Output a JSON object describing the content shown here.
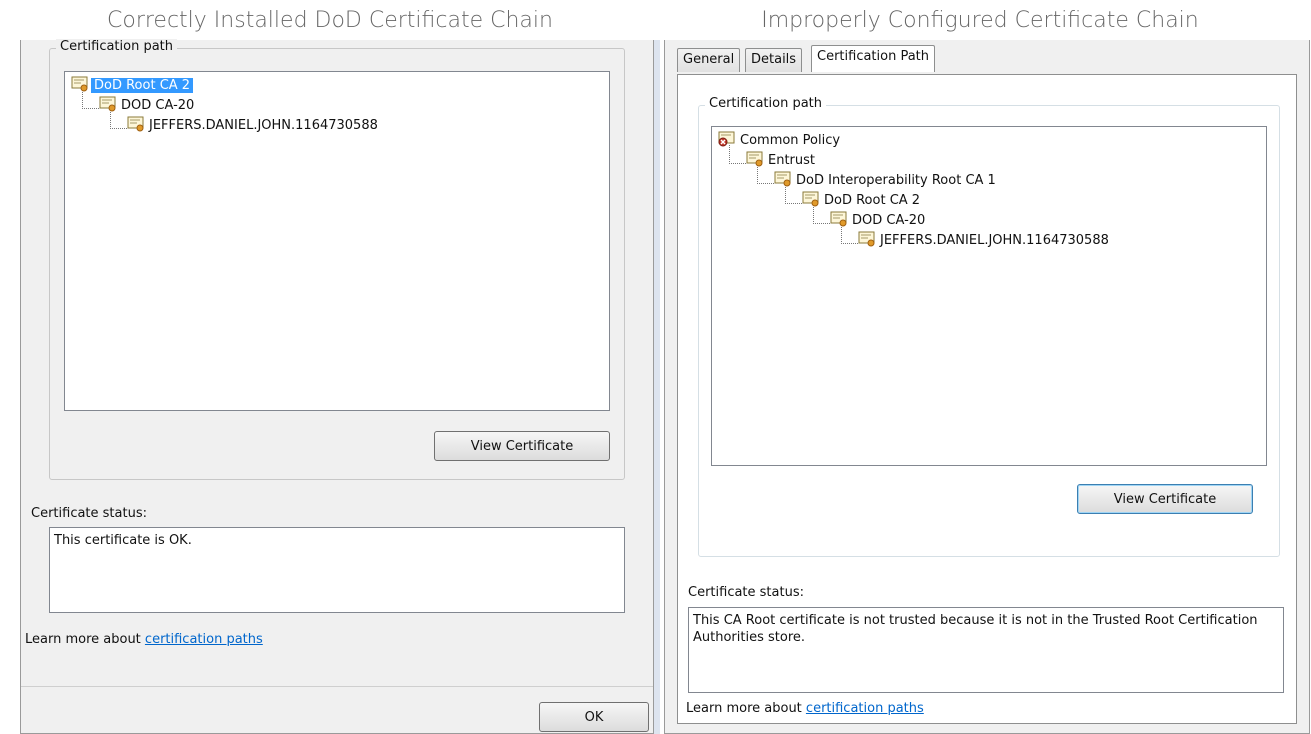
{
  "captions": {
    "left": "Correctly Installed DoD Certificate Chain",
    "right": "Improperly Configured Certificate Chain"
  },
  "left": {
    "cert_path_label": "Certification path",
    "tree": [
      {
        "label": "DoD Root CA 2",
        "selected": true,
        "icon": "certificate-icon"
      },
      {
        "label": "DOD CA-20",
        "selected": false,
        "icon": "certificate-icon"
      },
      {
        "label": "JEFFERS.DANIEL.JOHN.1164730588",
        "selected": false,
        "icon": "certificate-icon"
      }
    ],
    "view_button": "View Certificate",
    "status_label": "Certificate status:",
    "status_text": "This certificate is OK.",
    "learn_prefix": "Learn more about ",
    "learn_link": "certification paths",
    "ok_button": "OK"
  },
  "right": {
    "tabs": [
      "General",
      "Details",
      "Certification Path"
    ],
    "active_tab": "Certification Path",
    "cert_path_label": "Certification path",
    "tree": [
      {
        "label": "Common Policy",
        "selected": false,
        "icon": "untrusted-certificate-icon"
      },
      {
        "label": "Entrust",
        "selected": false,
        "icon": "certificate-icon"
      },
      {
        "label": "DoD Interoperability Root CA 1",
        "selected": false,
        "icon": "certificate-icon"
      },
      {
        "label": "DoD Root CA 2",
        "selected": false,
        "icon": "certificate-icon"
      },
      {
        "label": "DOD CA-20",
        "selected": false,
        "icon": "certificate-icon"
      },
      {
        "label": "JEFFERS.DANIEL.JOHN.1164730588",
        "selected": false,
        "icon": "certificate-icon"
      }
    ],
    "view_button": "View Certificate",
    "status_label": "Certificate status:",
    "status_text": "This CA Root certificate is not trusted because it is not in the Trusted Root Certification Authorities store.",
    "learn_prefix": "Learn more about ",
    "learn_link": "certification paths"
  },
  "colors": {
    "selection": "#3399ff",
    "link": "#0066cc",
    "dialog_bg": "#f0f0f0",
    "untrusted_badge": "#c0392b"
  }
}
